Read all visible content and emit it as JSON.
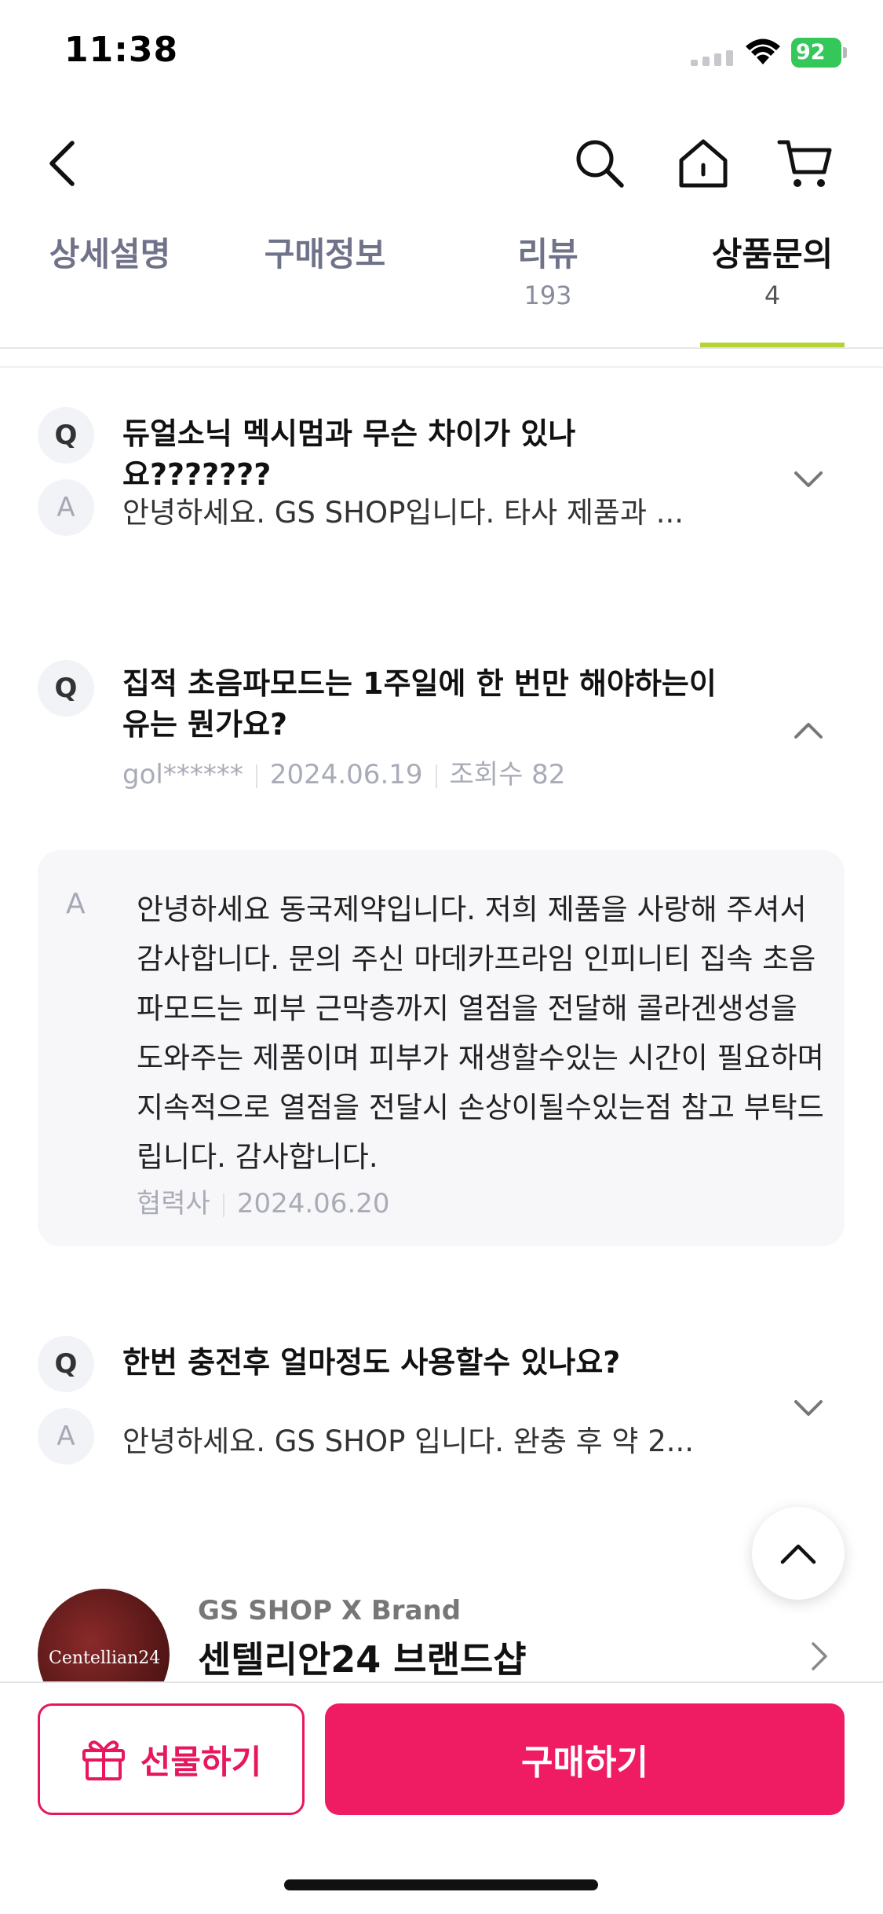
{
  "status_bar": {
    "time": "11:38",
    "battery": "92"
  },
  "tabs": [
    {
      "label": "상세설명",
      "count": ""
    },
    {
      "label": "구매정보",
      "count": ""
    },
    {
      "label": "리뷰",
      "count": "193"
    },
    {
      "label": "상품문의",
      "count": "4"
    }
  ],
  "qa": [
    {
      "q_badge": "Q",
      "a_badge": "A",
      "question": "듀얼소닉 멕시멈과 무슨 차이가 있나요???????",
      "answer_preview": "안녕하세요. GS SHOP입니다.  타사 제품과 ..."
    },
    {
      "q_badge": "Q",
      "a_badge": "A",
      "question": "집적 초음파모드는 1주일에 한 번만 해야하는이유는 뭔가요?",
      "author": "gol******",
      "date": "2024.06.19",
      "views": "조회수 82",
      "answer": "안녕하세요 동국제약입니다. 저희 제품을 사랑해 주셔서 감사합니다.  문의 주신 마데카프라임 인피니티 집속 초음파모드는 피부 근막층까지 열점을 전달해 콜라겐생성을 도와주는  제품이며 피부가 재생할수있는 시간이 필요하며 지속적으로 열점을 전달시 손상이될수있는점 참고 부탁드립니다. 감사합니다.",
      "answer_author": "협력사",
      "answer_date": "2024.06.20"
    },
    {
      "q_badge": "Q",
      "a_badge": "A",
      "question": "한번 충전후 얼마정도 사용할수 있나요?",
      "answer_preview": "안녕하세요. GS SHOP 입니다.  완충 후 약 2..."
    }
  ],
  "brand": {
    "logo_text": "Centellian24",
    "subtitle": "GS SHOP X Brand",
    "name": "센텔리안24 브랜드샵"
  },
  "bottom": {
    "gift_label": "선물하기",
    "buy_label": "구매하기"
  },
  "colors": {
    "accent": "#ef1c64",
    "tab_underline": "#b5d335",
    "battery": "#34c759"
  }
}
